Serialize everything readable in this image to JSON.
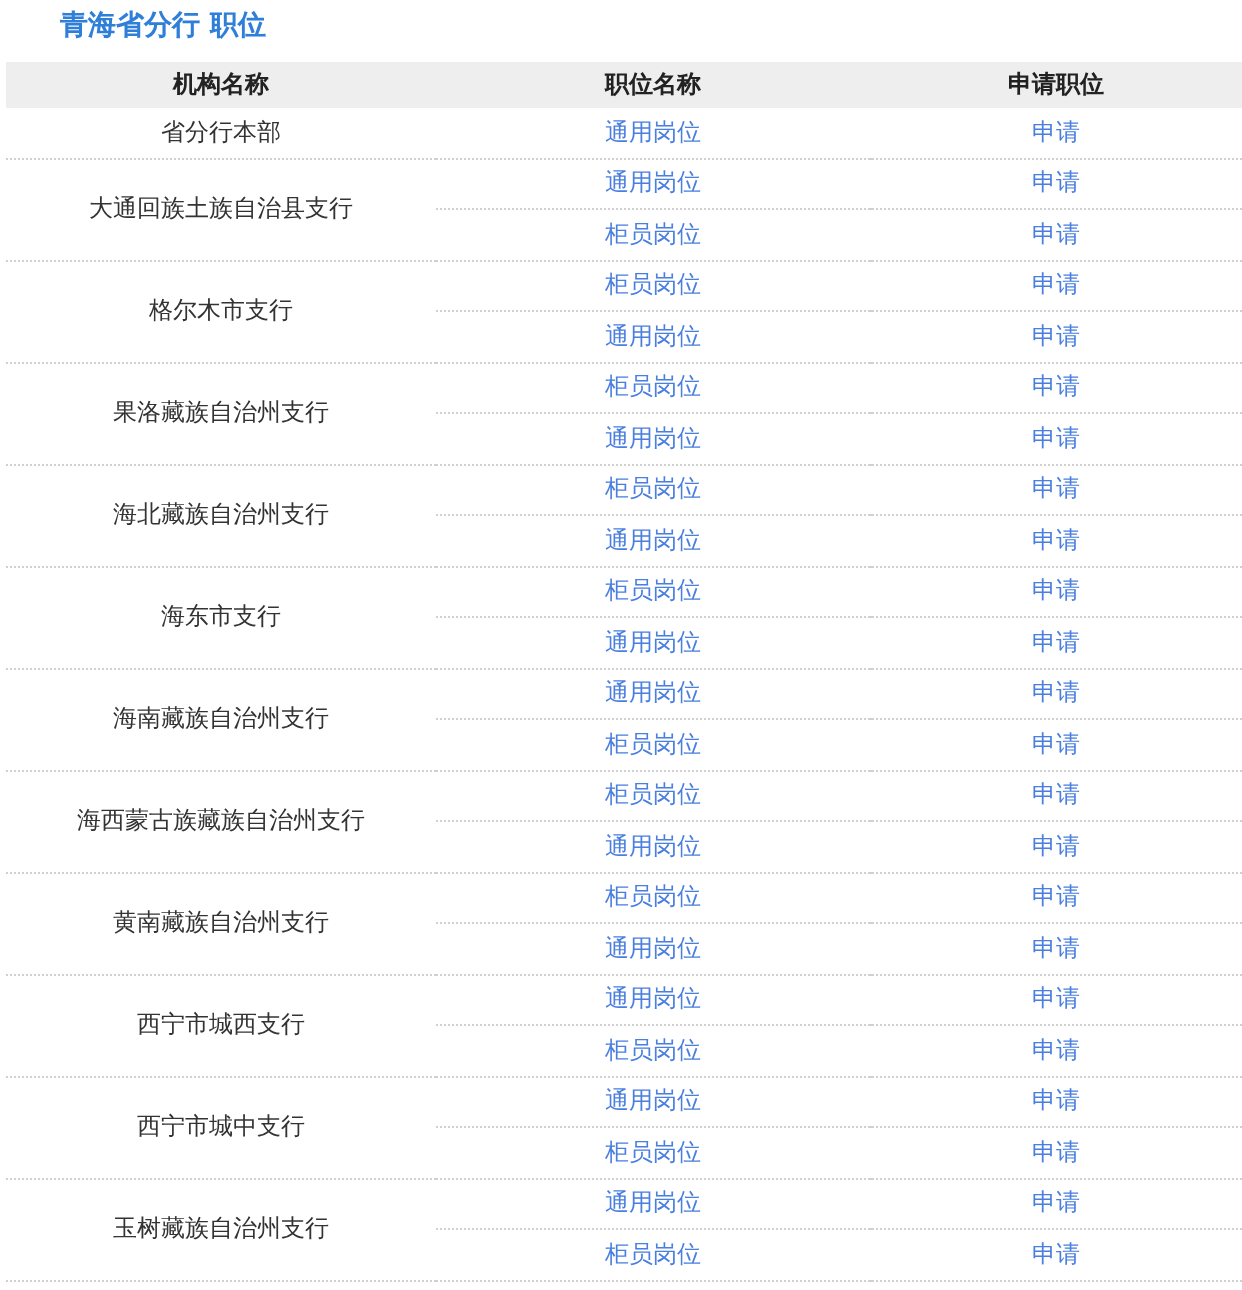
{
  "title": "青海省分行 职位",
  "columns": [
    "机构名称",
    "职位名称",
    "申请职位"
  ],
  "branches": [
    {
      "name": "省分行本部",
      "positions": [
        {
          "title": "通用岗位",
          "action": "申请"
        }
      ]
    },
    {
      "name": "大通回族土族自治县支行",
      "positions": [
        {
          "title": "通用岗位",
          "action": "申请"
        },
        {
          "title": "柜员岗位",
          "action": "申请"
        }
      ]
    },
    {
      "name": "格尔木市支行",
      "positions": [
        {
          "title": "柜员岗位",
          "action": "申请"
        },
        {
          "title": "通用岗位",
          "action": "申请"
        }
      ]
    },
    {
      "name": "果洛藏族自治州支行",
      "positions": [
        {
          "title": "柜员岗位",
          "action": "申请"
        },
        {
          "title": "通用岗位",
          "action": "申请"
        }
      ]
    },
    {
      "name": "海北藏族自治州支行",
      "positions": [
        {
          "title": "柜员岗位",
          "action": "申请"
        },
        {
          "title": "通用岗位",
          "action": "申请"
        }
      ]
    },
    {
      "name": "海东市支行",
      "positions": [
        {
          "title": "柜员岗位",
          "action": "申请"
        },
        {
          "title": "通用岗位",
          "action": "申请"
        }
      ]
    },
    {
      "name": "海南藏族自治州支行",
      "positions": [
        {
          "title": "通用岗位",
          "action": "申请"
        },
        {
          "title": "柜员岗位",
          "action": "申请"
        }
      ]
    },
    {
      "name": "海西蒙古族藏族自治州支行",
      "positions": [
        {
          "title": "柜员岗位",
          "action": "申请"
        },
        {
          "title": "通用岗位",
          "action": "申请"
        }
      ]
    },
    {
      "name": "黄南藏族自治州支行",
      "positions": [
        {
          "title": "柜员岗位",
          "action": "申请"
        },
        {
          "title": "通用岗位",
          "action": "申请"
        }
      ]
    },
    {
      "name": "西宁市城西支行",
      "positions": [
        {
          "title": "通用岗位",
          "action": "申请"
        },
        {
          "title": "柜员岗位",
          "action": "申请"
        }
      ]
    },
    {
      "name": "西宁市城中支行",
      "positions": [
        {
          "title": "通用岗位",
          "action": "申请"
        },
        {
          "title": "柜员岗位",
          "action": "申请"
        }
      ]
    },
    {
      "name": "玉树藏族自治州支行",
      "positions": [
        {
          "title": "通用岗位",
          "action": "申请"
        },
        {
          "title": "柜员岗位",
          "action": "申请"
        }
      ]
    }
  ]
}
